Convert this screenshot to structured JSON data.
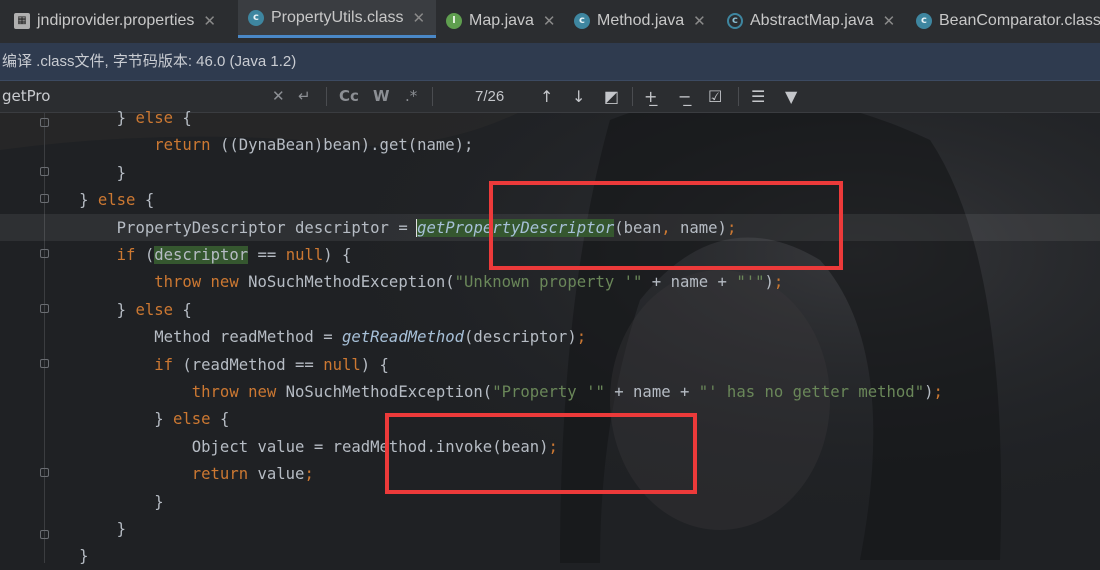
{
  "tabs": [
    {
      "label": "jndiprovider.properties",
      "icon": "properties-file-icon",
      "active": false
    },
    {
      "label": "PropertyUtils.class",
      "icon": "class-file-icon",
      "active": true
    },
    {
      "label": "Map.java",
      "icon": "interface-icon",
      "active": false
    },
    {
      "label": "Method.java",
      "icon": "class-file-icon",
      "active": false
    },
    {
      "label": "AbstractMap.java",
      "icon": "abstract-class-icon",
      "active": false
    },
    {
      "label": "BeanComparator.class",
      "icon": "class-file-icon",
      "active": false
    }
  ],
  "info_bar": {
    "text": "编译 .class文件, 字节码版本: 46.0 (Java 1.2)"
  },
  "find": {
    "query": "getPro",
    "match_case": "Cc",
    "words": "W",
    "regex": ".*",
    "counter": "7/26"
  },
  "code_lines": [
    {
      "indent": "        ",
      "tokens": [
        [
          "plain",
          "} "
        ],
        [
          "kw",
          "else"
        ],
        [
          "plain",
          " {"
        ]
      ]
    },
    {
      "indent": "            ",
      "tokens": [
        [
          "kw",
          "return"
        ],
        [
          "plain",
          " ((DynaBean)bean).get(name);"
        ]
      ]
    },
    {
      "indent": "        ",
      "tokens": [
        [
          "plain",
          "}"
        ]
      ]
    },
    {
      "indent": "    ",
      "tokens": [
        [
          "plain",
          "} "
        ],
        [
          "kw",
          "else"
        ],
        [
          "plain",
          " {"
        ]
      ]
    },
    {
      "indent": "        ",
      "tokens": [
        [
          "plain",
          "PropertyDescriptor descriptor = "
        ],
        [
          "fnhl",
          "getPropertyDescriptor"
        ],
        [
          "plain",
          "(bean"
        ],
        [
          "kw",
          ","
        ],
        [
          "plain",
          " name)"
        ],
        [
          "kw",
          ";"
        ]
      ]
    },
    {
      "indent": "        ",
      "tokens": [
        [
          "kw",
          "if"
        ],
        [
          "plain",
          " ("
        ],
        [
          "hl",
          "descriptor"
        ],
        [
          "plain",
          " == "
        ],
        [
          "kw",
          "null"
        ],
        [
          "plain",
          ") {"
        ]
      ]
    },
    {
      "indent": "            ",
      "tokens": [
        [
          "kw",
          "throw new"
        ],
        [
          "plain",
          " NoSuchMethodException("
        ],
        [
          "str",
          "\"Unknown property '\""
        ],
        [
          "plain",
          " + name + "
        ],
        [
          "str",
          "\"'\""
        ],
        [
          "plain",
          ")"
        ],
        [
          "kw",
          ";"
        ]
      ]
    },
    {
      "indent": "        ",
      "tokens": [
        [
          "plain",
          "} "
        ],
        [
          "kw",
          "else"
        ],
        [
          "plain",
          " {"
        ]
      ]
    },
    {
      "indent": "            ",
      "tokens": [
        [
          "plain",
          "Method readMethod = "
        ],
        [
          "fn",
          "getReadMethod"
        ],
        [
          "plain",
          "(descriptor)"
        ],
        [
          "kw",
          ";"
        ]
      ]
    },
    {
      "indent": "            ",
      "tokens": [
        [
          "kw",
          "if"
        ],
        [
          "plain",
          " (readMethod == "
        ],
        [
          "kw",
          "null"
        ],
        [
          "plain",
          ") {"
        ]
      ]
    },
    {
      "indent": "                ",
      "tokens": [
        [
          "kw",
          "throw new"
        ],
        [
          "plain",
          " NoSuchMethodException("
        ],
        [
          "str",
          "\"Property '\""
        ],
        [
          "plain",
          " + name + "
        ],
        [
          "str",
          "\"' has no getter method\""
        ],
        [
          "plain",
          ")"
        ],
        [
          "kw",
          ";"
        ]
      ]
    },
    {
      "indent": "            ",
      "tokens": [
        [
          "plain",
          "} "
        ],
        [
          "kw",
          "else"
        ],
        [
          "plain",
          " {"
        ]
      ]
    },
    {
      "indent": "                ",
      "tokens": [
        [
          "plain",
          "Object value = readMethod.invoke(bean)"
        ],
        [
          "kw",
          ";"
        ]
      ]
    },
    {
      "indent": "                ",
      "tokens": [
        [
          "kw",
          "return"
        ],
        [
          "plain",
          " value"
        ],
        [
          "kw",
          ";"
        ]
      ]
    },
    {
      "indent": "            ",
      "tokens": [
        [
          "plain",
          "}"
        ]
      ]
    },
    {
      "indent": "        ",
      "tokens": [
        [
          "plain",
          "}"
        ]
      ]
    },
    {
      "indent": "    ",
      "tokens": [
        [
          "plain",
          "}"
        ]
      ]
    }
  ],
  "colors": {
    "annotation_box": "#ec3a3a",
    "keyword": "#cc7832",
    "string": "#6a8759",
    "active_tab_underline": "#4a88c7"
  }
}
